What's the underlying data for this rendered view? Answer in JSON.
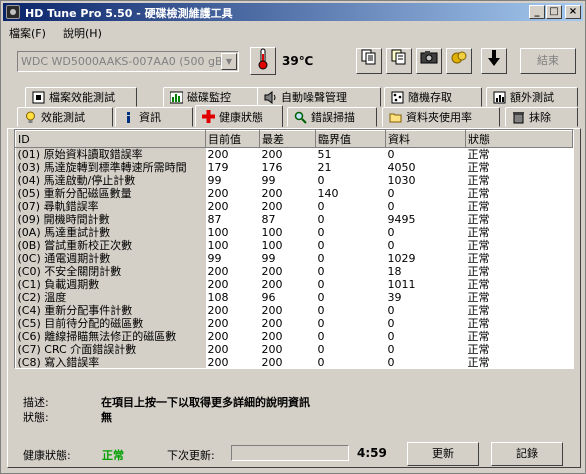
{
  "window": {
    "title": "HD Tune Pro 5.50 - 硬碟檢測維護工具"
  },
  "menu": [
    "檔案(F)",
    "說明(H)"
  ],
  "toolbar": {
    "drive": "WDC WD5000AAKS-007AA0 (500 gB)",
    "temperature": "39℃",
    "exit_label": "結束"
  },
  "tabs_row1": [
    "檔案效能測試",
    "磁碟監控",
    "自動噪聲管理",
    "隨機存取",
    "額外測試"
  ],
  "tabs_row2": [
    "效能測試",
    "資訊",
    "健康狀態",
    "錯誤掃描",
    "資料夾使用率",
    "抹除"
  ],
  "table": {
    "headers": [
      "ID",
      "目前值",
      "最差",
      "臨界值",
      "資料",
      "狀態"
    ],
    "rows": [
      [
        "(01) 原始資料讀取錯誤率",
        "200",
        "200",
        "51",
        "0",
        "正常"
      ],
      [
        "(03) 馬達旋轉到標準轉速所需時間",
        "179",
        "176",
        "21",
        "4050",
        "正常"
      ],
      [
        "(04) 馬達啟動/停止計數",
        "99",
        "99",
        "0",
        "1030",
        "正常"
      ],
      [
        "(05) 重新分配磁區數量",
        "200",
        "200",
        "140",
        "0",
        "正常"
      ],
      [
        "(07) 尋軌錯誤率",
        "200",
        "200",
        "0",
        "0",
        "正常"
      ],
      [
        "(09) 開機時間計數",
        "87",
        "87",
        "0",
        "9495",
        "正常"
      ],
      [
        "(0A) 馬達重試計數",
        "100",
        "100",
        "0",
        "0",
        "正常"
      ],
      [
        "(0B) 嘗試重新校正次數",
        "100",
        "100",
        "0",
        "0",
        "正常"
      ],
      [
        "(0C) 通電週期計數",
        "99",
        "99",
        "0",
        "1029",
        "正常"
      ],
      [
        "(C0) 不安全關閉計數",
        "200",
        "200",
        "0",
        "18",
        "正常"
      ],
      [
        "(C1) 負載週期數",
        "200",
        "200",
        "0",
        "1011",
        "正常"
      ],
      [
        "(C2) 溫度",
        "108",
        "96",
        "0",
        "39",
        "正常"
      ],
      [
        "(C4) 重新分配事件計數",
        "200",
        "200",
        "0",
        "0",
        "正常"
      ],
      [
        "(C5) 目前待分配的磁區數",
        "200",
        "200",
        "0",
        "0",
        "正常"
      ],
      [
        "(C6) 離線掃瞄無法修正的磁區數",
        "200",
        "200",
        "0",
        "0",
        "正常"
      ],
      [
        "(C7) CRC 介面錯誤計數",
        "200",
        "200",
        "0",
        "0",
        "正常"
      ],
      [
        "(C8) 寫入錯誤率",
        "200",
        "200",
        "0",
        "0",
        "正常"
      ]
    ]
  },
  "details": {
    "desc_label": "描述:",
    "desc_value": "在項目上按一下以取得更多詳細的說明資訊",
    "status_label": "狀態:",
    "status_value": "無"
  },
  "status": {
    "health_label": "健康狀態:",
    "health_value": "正常",
    "next_label": "下次更新:",
    "progress": 0,
    "countdown": "4:59",
    "refresh_label": "更新",
    "log_label": "記錄"
  },
  "colors": {
    "title_gradient_start": "#0a246a",
    "ok_green": "#00a000",
    "window_bg": "#d4d0c8"
  }
}
